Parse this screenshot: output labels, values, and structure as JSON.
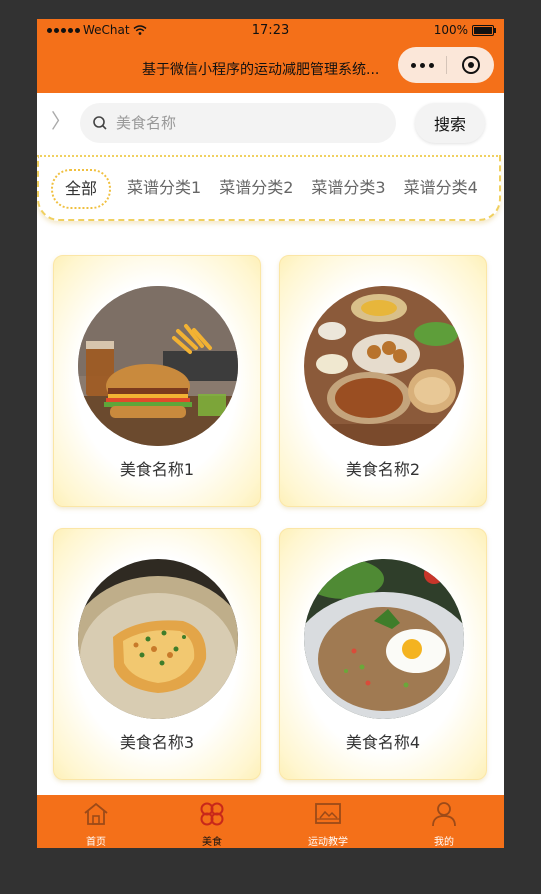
{
  "status_bar": {
    "carrier": "WeChat",
    "time": "17:23",
    "battery": "100%"
  },
  "navbar": {
    "title": "基于微信小程序的运动减肥管理系统..."
  },
  "search": {
    "placeholder": "美食名称",
    "button_label": "搜索",
    "back_symbol": "〉"
  },
  "categories": [
    "全部",
    "菜谱分类1",
    "菜谱分类2",
    "菜谱分类3",
    "菜谱分类4"
  ],
  "foods": [
    {
      "name": "美食名称1",
      "image": "burger-photo"
    },
    {
      "name": "美食名称2",
      "image": "mezze-platter-photo"
    },
    {
      "name": "美食名称3",
      "image": "hash-brown-photo"
    },
    {
      "name": "美食名称4",
      "image": "fried-rice-egg-photo"
    }
  ],
  "tabbar": {
    "items": [
      {
        "label": "首页",
        "icon": "home-icon",
        "active": false
      },
      {
        "label": "美食",
        "icon": "food-icon",
        "active": true
      },
      {
        "label": "运动教学",
        "icon": "video-icon",
        "active": false
      },
      {
        "label": "我的",
        "icon": "user-icon",
        "active": false
      }
    ]
  },
  "colors": {
    "theme": "#f47019",
    "card_glow": "#fdf0b8",
    "tab_border": "#f0c040"
  }
}
